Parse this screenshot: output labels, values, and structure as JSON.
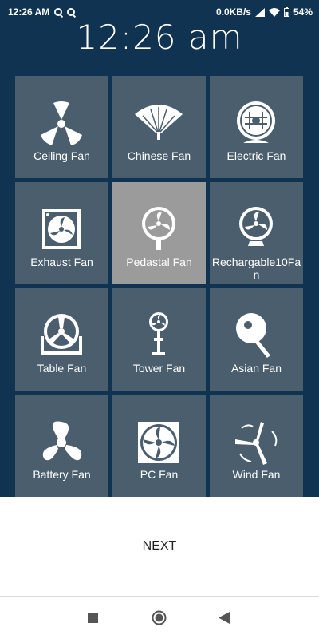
{
  "status_bar": {
    "time": "12:26 AM",
    "left_icons": [
      "q-notification-icon",
      "q-notification-icon"
    ],
    "network_speed": "0.0KB/s",
    "battery": "54%"
  },
  "clock": "12:26 am",
  "tiles": [
    {
      "label": "Ceiling Fan",
      "icon": "ceiling-fan-icon"
    },
    {
      "label": "Chinese Fan",
      "icon": "chinese-fan-icon"
    },
    {
      "label": "Electric Fan",
      "icon": "electric-fan-icon"
    },
    {
      "label": "Exhaust Fan",
      "icon": "exhaust-fan-icon"
    },
    {
      "label": "Pedastal Fan",
      "icon": "pedestal-fan-icon",
      "selected": true
    },
    {
      "label": "Rechargable10Fan",
      "icon": "rechargeable-fan-icon"
    },
    {
      "label": "Table Fan",
      "icon": "table-fan-icon"
    },
    {
      "label": "Tower Fan",
      "icon": "tower-fan-icon"
    },
    {
      "label": "Asian Fan",
      "icon": "asian-fan-icon"
    },
    {
      "label": "Battery Fan",
      "icon": "battery-fan-icon"
    },
    {
      "label": "PC Fan",
      "icon": "pc-fan-icon"
    },
    {
      "label": "Wind Fan",
      "icon": "wind-fan-icon"
    }
  ],
  "next_button": {
    "label": "NEXT"
  },
  "colors": {
    "background": "#0f3350",
    "tile": "#4a5e6d",
    "tile_selected": "#9b9b9b"
  },
  "nav_bar": [
    "recents-square-icon",
    "home-circle-icon",
    "back-triangle-icon"
  ]
}
